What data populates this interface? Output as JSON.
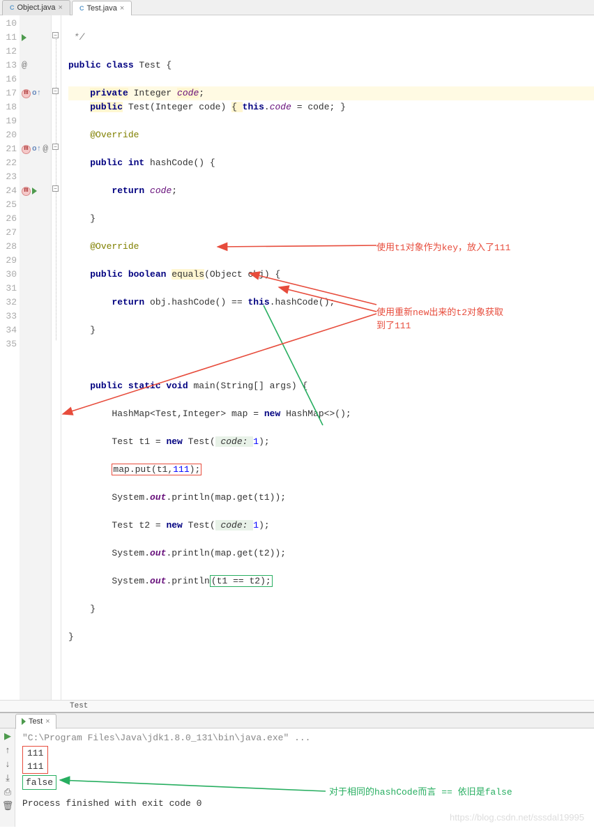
{
  "tabs": [
    {
      "label": "Object.java",
      "active": false
    },
    {
      "label": "Test.java",
      "active": true
    }
  ],
  "line_numbers": [
    "10",
    "11",
    "12",
    "13",
    "16",
    "17",
    "18",
    "19",
    "20",
    "21",
    "22",
    "23",
    "24",
    "25",
    "26",
    "27",
    "28",
    "29",
    "30",
    "31",
    "32",
    "33",
    "34",
    "35"
  ],
  "gutter_marks": {
    "1": "run",
    "3": "override-at",
    "5": "m-o",
    "9": "m-o-at",
    "12": "m-run"
  },
  "code": {
    "l0": " */",
    "l1_a": "public",
    "l1_b": " class",
    "l1_c": " Test {",
    "l2_a": "    ",
    "l2_b": "private",
    "l2_c": " Integer ",
    "l2_d": "code",
    "l2_e": ";",
    "l3_a": "    ",
    "l3_b": "public",
    "l3_c": " Test(Integer code) ",
    "l3_d": "{ ",
    "l3_e": "this",
    "l3_f": ".",
    "l3_g": "code",
    "l3_h": " = code; }",
    "l4_a": "    ",
    "l4_b": "@Override",
    "l5_a": "    ",
    "l5_b": "public int",
    "l5_c": " hashCode() {",
    "l6_a": "        ",
    "l6_b": "return",
    "l6_c": " ",
    "l6_d": "code",
    "l6_e": ";",
    "l7": "    }",
    "l8_a": "    ",
    "l8_b": "@Override",
    "l9_a": "    ",
    "l9_b": "public boolean",
    "l9_c": " ",
    "l9_d": "equals",
    "l9_e": "(Object obj) {",
    "l10_a": "        ",
    "l10_b": "return",
    "l10_c": " obj.hashCode() == ",
    "l10_d": "this",
    "l10_e": ".hashCode();",
    "l11": "    }",
    "l12": "",
    "l13_a": "    ",
    "l13_b": "public static void",
    "l13_c": " main(String[] args) {",
    "l14_a": "        HashMap<Test,Integer> map = ",
    "l14_b": "new",
    "l14_c": " HashMap<>();",
    "l15_a": "        Test t1 = ",
    "l15_b": "new",
    "l15_c": " Test(",
    "l15_d": " code: ",
    "l15_e": "1",
    "l15_f": ");",
    "l16_a": "        ",
    "l16_b": "map.put(t1,",
    "l16_c": "111",
    "l16_d": ");",
    "l17_a": "        System.",
    "l17_b": "out",
    "l17_c": ".println(map.get(t1));",
    "l18_a": "        Test t2 = ",
    "l18_b": "new",
    "l18_c": " Test(",
    "l18_d": " code: ",
    "l18_e": "1",
    "l18_f": ");",
    "l19_a": "        System.",
    "l19_b": "out",
    "l19_c": ".println(map.get(t2));",
    "l20_a": "        System.",
    "l20_b": "out",
    "l20_c": ".println",
    "l20_d": "(t1 == t2);",
    "l21": "    }",
    "l22": "}",
    "l23": ""
  },
  "breadcrumb": "Test",
  "annotations": {
    "a1": "使用t1对象作为key，放入了111",
    "a2": "使用重新new出来的t2对象获取",
    "a2b": "到了111",
    "a3": "对于相同的hashCode而言 == 依旧是false"
  },
  "console": {
    "tab": "Test",
    "cmd": "\"C:\\Program Files\\Java\\jdk1.8.0_131\\bin\\java.exe\" ...",
    "out1": "111",
    "out2": "111",
    "out3": "false",
    "exit": "Process finished with exit code 0"
  },
  "toolbar_icons": {
    "run": "▶",
    "up": "↑",
    "down": "↓",
    "export": "⤓",
    "print": "⎙",
    "trash": "🗑"
  },
  "watermark": "https://blog.csdn.net/sssdal19995"
}
